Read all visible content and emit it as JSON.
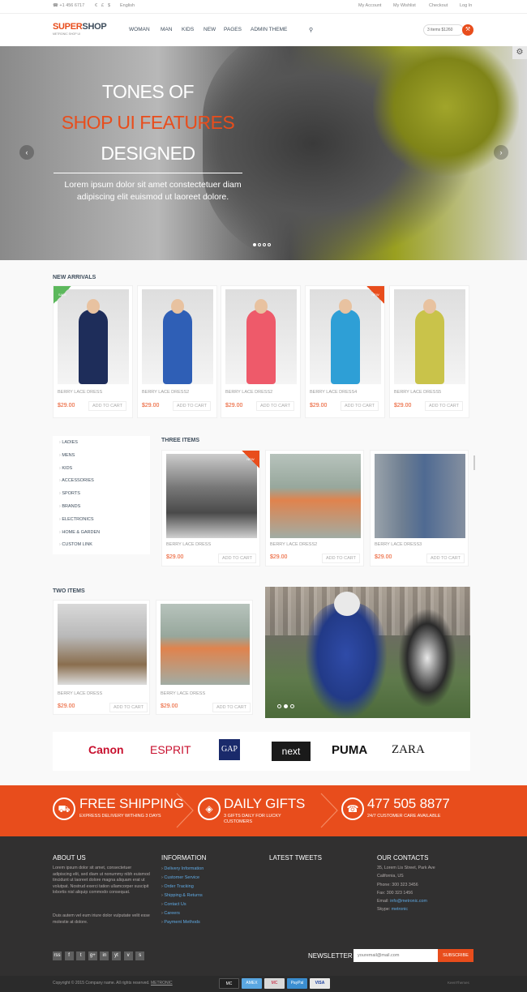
{
  "topbar": {
    "phone": "+1 456 6717",
    "currencies": [
      "€",
      "£",
      "$"
    ],
    "language": "English",
    "links": [
      "My Account",
      "My Wishlist",
      "Checkout",
      "Log In"
    ]
  },
  "header": {
    "logo_a": "SUPER",
    "logo_b": "SHOP",
    "logo_sub": "METRONIC SHOP UI",
    "nav": [
      "WOMAN",
      "MAN",
      "KIDS",
      "NEW",
      "PAGES",
      "ADMIN THEME"
    ],
    "cart_summary": "3 items $1260"
  },
  "hero": {
    "line1": "TONES OF",
    "line2": "SHOP UI FEATURES",
    "line3": "DESIGNED",
    "text": "Lorem ipsum dolor sit amet constectetuer diam adipiscing elit euismod ut laoreet dolore.",
    "slide_count": 4,
    "active_slide": 1
  },
  "new_arrivals": {
    "title": "NEW ARRIVALS",
    "products": [
      {
        "name": "BERRY LACE DRESS",
        "price": "$29.00",
        "add": "ADD TO CART",
        "badge": "SALE",
        "outfit": "#1e2d5a"
      },
      {
        "name": "BERRY LACE DRESS2",
        "price": "$29.00",
        "add": "ADD TO CART",
        "badge": "",
        "outfit": "#2f5fb6"
      },
      {
        "name": "BERRY LACE DRESS2",
        "price": "$29.00",
        "add": "ADD TO CART",
        "badge": "",
        "outfit": "#ee5a6a"
      },
      {
        "name": "BERRY LACE DRESS4",
        "price": "$29.00",
        "add": "ADD TO CART",
        "badge": "NEW",
        "outfit": "#2e9fd6"
      },
      {
        "name": "BERRY LACE DRESS5",
        "price": "$29.00",
        "add": "ADD TO CART",
        "badge": "",
        "outfit": "#c9c34a"
      }
    ]
  },
  "sidebar": {
    "items": [
      "LADIES",
      "MENS",
      "KIDS",
      "ACCESSORIES",
      "SPORTS",
      "BRANDS",
      "ELECTRONICS",
      "HOME & GARDEN",
      "CUSTOM LINK"
    ]
  },
  "three_items": {
    "title": "THREE ITEMS",
    "products": [
      {
        "name": "BERRY LACE DRESS",
        "price": "$29.00",
        "add": "ADD TO CART",
        "badge": "NEW"
      },
      {
        "name": "BERRY LACE DRESS2",
        "price": "$29.00",
        "add": "ADD TO CART",
        "badge": ""
      },
      {
        "name": "BERRY LACE DRESS3",
        "price": "$29.00",
        "add": "ADD TO CART",
        "badge": ""
      }
    ]
  },
  "two_items": {
    "title": "TWO ITEMS",
    "products": [
      {
        "name": "BERRY LACE DRESS",
        "price": "$29.00",
        "add": "ADD TO CART"
      },
      {
        "name": "BERRY LACE DRESS",
        "price": "$29.00",
        "add": "ADD TO CART"
      }
    ]
  },
  "brands": [
    "Canon",
    "ESPRIT",
    "GAP",
    "next",
    "PUMA",
    "ZARA"
  ],
  "promo": [
    {
      "icon": "truck-icon",
      "title": "FREE SHIPPING",
      "sub": "EXPRESS DELIVERY WITHING 3 DAYS"
    },
    {
      "icon": "gift-icon",
      "title": "DAILY GIFTS",
      "sub": "3 GIFTS DAILY FOR LUCKY CUSTOMERS"
    },
    {
      "icon": "phone-icon",
      "title": "477 505 8877",
      "sub": "24/7 CUSTOMER CARE AVAILABLE"
    }
  ],
  "footer": {
    "about_title": "ABOUT US",
    "about_text": "Lorem ipsum dolor sit amet, consectetuer adipiscing elit, sed diam ut nonummy nibh euismod tincidunt ut laoreet dolore magna aliquam erat ut volutpat. Nostrud exerci tation ullamcorper suscipit lobortis nisl aliquip commodo consequat.",
    "about_text2": "Duis autem vel eum iriure dolor vulputate velit esse molestie at dolore.",
    "info_title": "INFORMATION",
    "info_links": [
      "Delivery Information",
      "Customer Service",
      "Order Tracking",
      "Shipping & Returns",
      "Contact Us",
      "Careers",
      "Payment Methods"
    ],
    "tweets_title": "LATEST TWEETS",
    "contacts_title": "OUR CONTACTS",
    "contacts": [
      "35, Lorem Lis Street, Park Ave",
      "California, US",
      "Phone: 300 323 3456",
      "Fax: 300 323 1456"
    ],
    "email_label": "Email:",
    "email": "info@metronic.com",
    "skype_label": "Skype:",
    "skype": "metronic",
    "social": [
      "rss",
      "f",
      "t",
      "g+",
      "in",
      "yt",
      "v",
      "s"
    ],
    "newsletter_label": "NEWSLETTER",
    "newsletter_placeholder": "youremail@mail.com",
    "subscribe": "SUBSCRIBE"
  },
  "bottom": {
    "copyright": "Copyright © 2015 Company name. All rights reserved.",
    "copyright_brand": "METRONIC",
    "payments": [
      "MC",
      "AMEX",
      "MC",
      "PayPal",
      "VISA"
    ],
    "powered": "KeenThemes"
  }
}
